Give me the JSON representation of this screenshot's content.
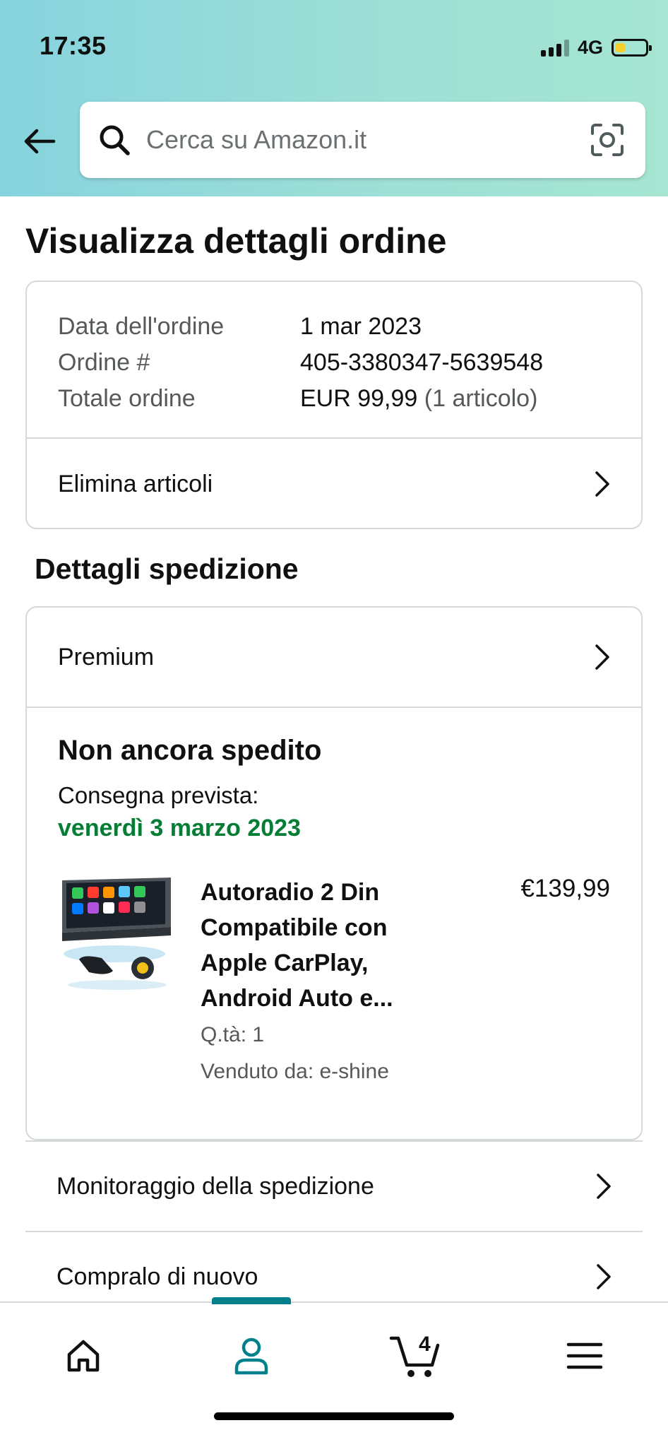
{
  "status_bar": {
    "time": "17:35",
    "network": "4G"
  },
  "search": {
    "placeholder": "Cerca su Amazon.it"
  },
  "page_title": "Visualizza dettagli ordine",
  "order": {
    "rows": [
      {
        "label": "Data dell'ordine",
        "value": "1 mar 2023",
        "extra": ""
      },
      {
        "label": "Ordine #",
        "value": "405-3380347-5639548",
        "extra": ""
      },
      {
        "label": "Totale ordine",
        "value": "EUR 99,99",
        "extra": "(1 articolo)"
      }
    ],
    "delete_items_label": "Elimina articoli"
  },
  "shipping": {
    "section_title": "Dettagli spedizione",
    "method_label": "Premium",
    "status": "Non ancora spedito",
    "delivery_label": "Consegna prevista:",
    "delivery_date": "venerdì 3 marzo 2023",
    "delivery_date_color": "#067d34",
    "product": {
      "name": "Autoradio 2 Din Compatibile con Apple CarPlay, Android Auto e...",
      "price": "€139,99",
      "qty": "Q.tà: 1",
      "seller": "Venduto da: e-shine"
    }
  },
  "actions": {
    "track_label": "Monitoraggio della spedizione",
    "buy_again_label": "Compralo di nuovo"
  },
  "bottom_nav": {
    "cart_count": "4",
    "active_tab": "account",
    "accent_color": "#00808a",
    "icons": [
      "home-icon",
      "account-icon",
      "cart-icon",
      "menu-icon"
    ]
  }
}
